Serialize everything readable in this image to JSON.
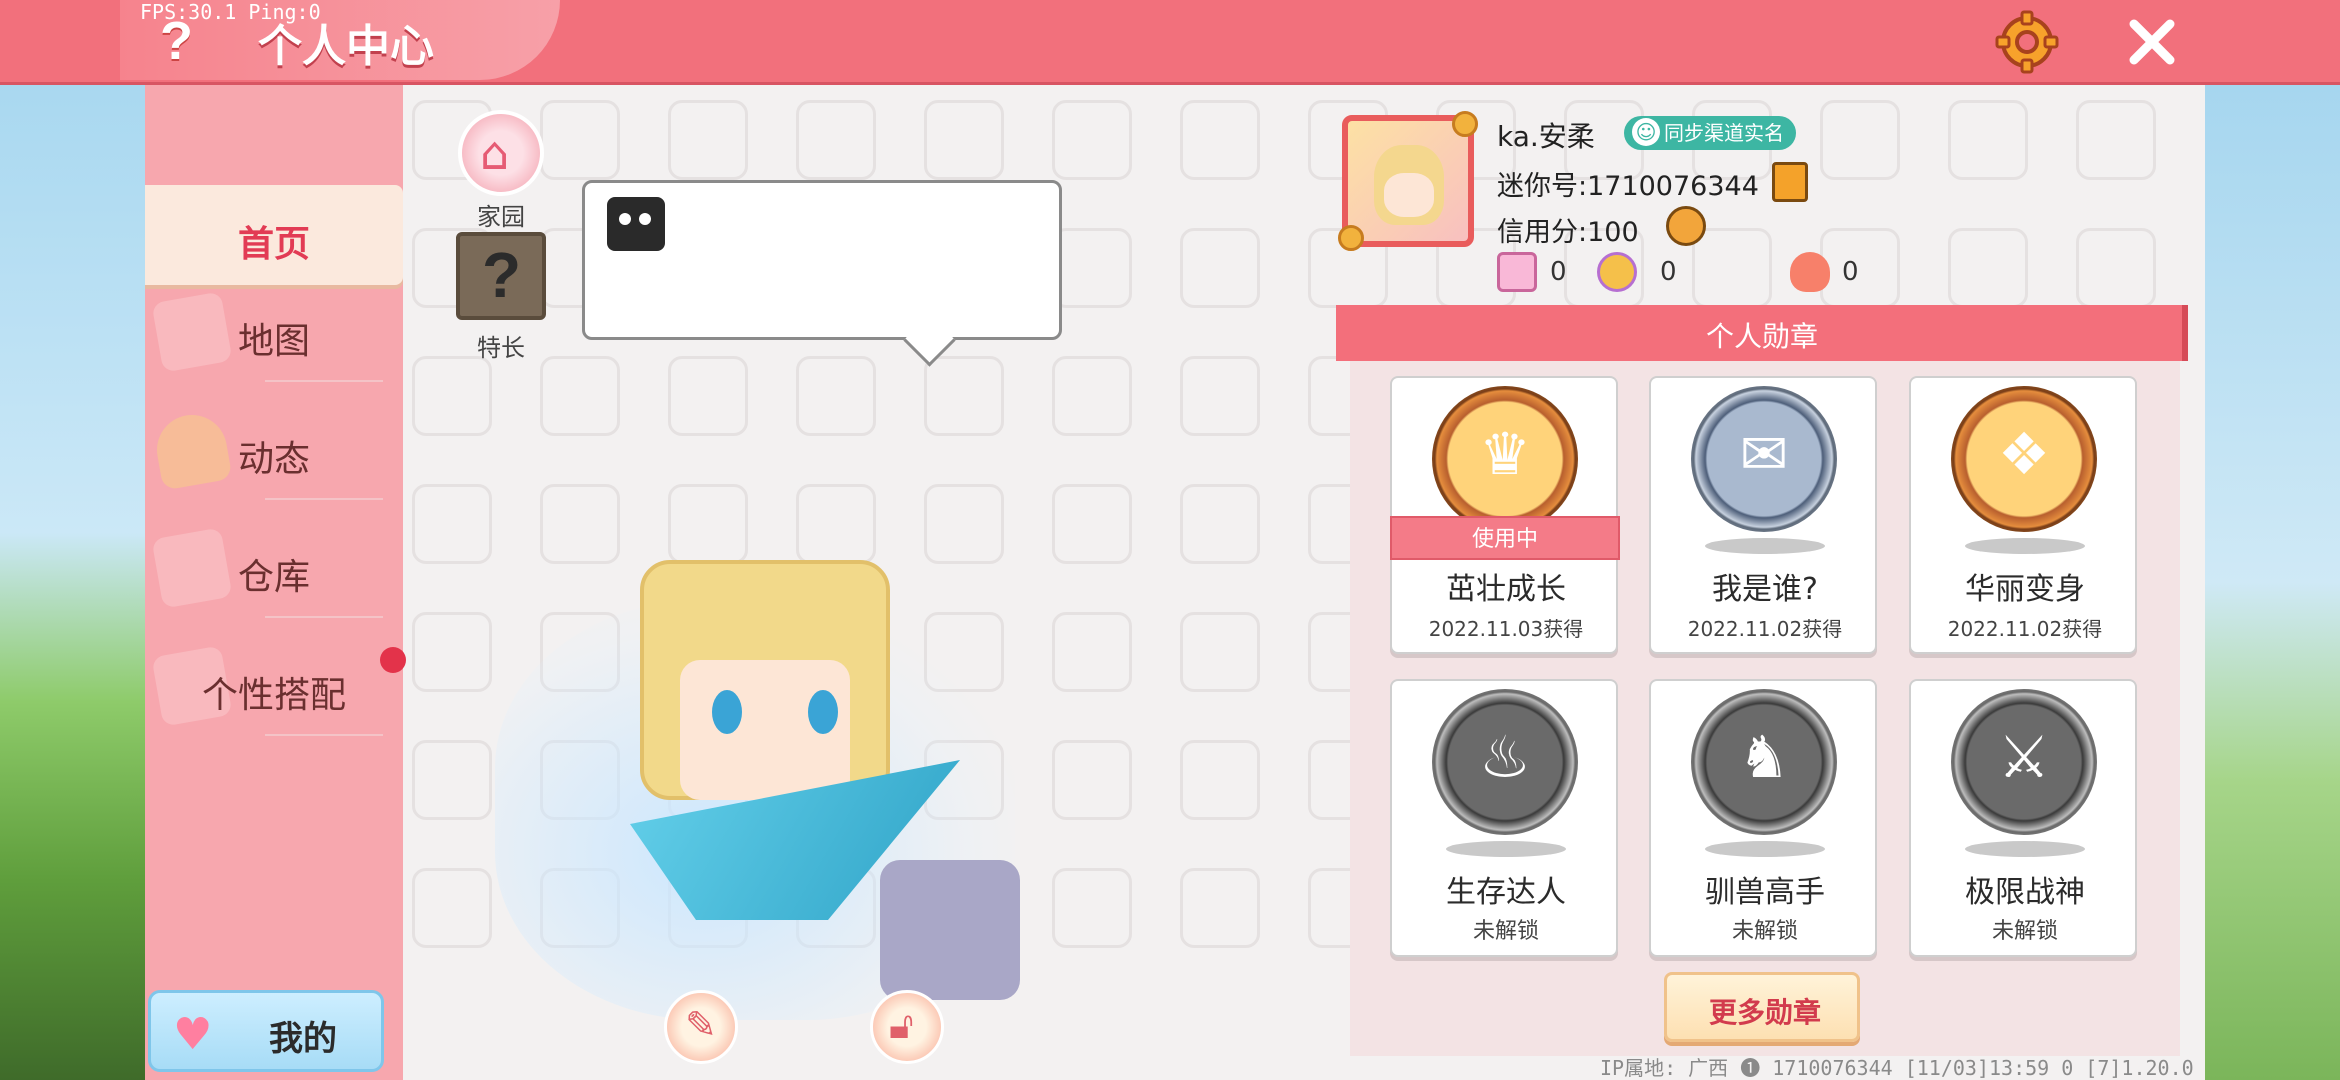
{
  "debug": {
    "fps_ping": "FPS:30.1  Ping:0"
  },
  "header": {
    "help_glyph": "?",
    "title": "个人中心"
  },
  "sidebar": {
    "items": [
      {
        "label": "首页",
        "active": true
      },
      {
        "label": "地图",
        "active": false
      },
      {
        "label": "动态",
        "active": false
      },
      {
        "label": "仓库",
        "active": false
      },
      {
        "label": "个性搭配",
        "active": false
      }
    ],
    "mine_button": "我的"
  },
  "home": {
    "label": "家园"
  },
  "specialty": {
    "label": "特长",
    "glyph": "?"
  },
  "profile": {
    "username": "ka.安柔",
    "sync_badge": "同步渠道实名",
    "mini_id": "迷你号:1710076344",
    "credit": "信用分:100",
    "stats": [
      {
        "icon": "star-card-icon",
        "value": "0"
      },
      {
        "icon": "fans-icon",
        "value": "0"
      },
      {
        "icon": "flame-icon",
        "value": "0"
      }
    ]
  },
  "badges": {
    "header": "个人勋章",
    "items": [
      {
        "name": "茁壮成长",
        "sub": "2022.11.03获得",
        "status": "使用中",
        "style": "gold",
        "icon": "dragon-icon"
      },
      {
        "name": "我是谁?",
        "sub": "2022.11.02获得",
        "status": "",
        "style": "silver",
        "icon": "envelope-icon"
      },
      {
        "name": "华丽变身",
        "sub": "2022.11.02获得",
        "status": "",
        "style": "gold",
        "icon": "dino-icon"
      },
      {
        "name": "生存达人",
        "sub": "未解锁",
        "status": "",
        "style": "gray",
        "icon": "campfire-icon"
      },
      {
        "name": "驯兽高手",
        "sub": "未解锁",
        "status": "",
        "style": "gray",
        "icon": "horse-icon"
      },
      {
        "name": "极限战神",
        "sub": "未解锁",
        "status": "",
        "style": "gray",
        "icon": "boss-icon"
      }
    ],
    "more_button": "更多勋章"
  },
  "footer": {
    "text": "IP属地: 广西 ❶   1710076344   [11/03]13:59 0  [7]1.20.0"
  },
  "colors": {
    "topbar": "#f2707c",
    "sidebar": "#f7a7ae",
    "accent_red": "#e23b54",
    "sync_badge": "#3db6a3"
  }
}
